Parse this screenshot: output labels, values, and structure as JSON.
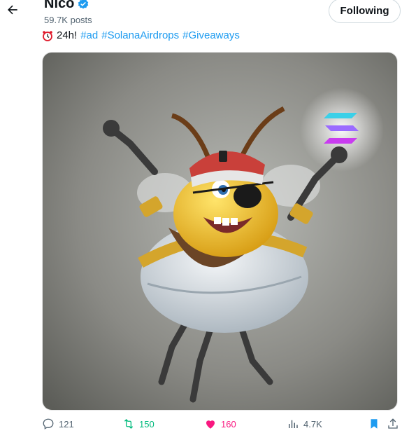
{
  "header": {
    "back_icon": "arrow-left-icon",
    "name": "Nico",
    "verified_icon": "verified-badge-icon",
    "posts": "59.7K posts",
    "follow_label": "Following"
  },
  "tweet": {
    "emoji_icon": "alarm-clock-icon",
    "text": "24h!",
    "hashtags": [
      "#ad",
      "#SolanaAirdrops",
      "#Giveaways"
    ]
  },
  "media": {
    "description_icon": "bee-mascot-image"
  },
  "actions": {
    "replies": "121",
    "retweets": "150",
    "likes": "160",
    "views": "4.7K"
  },
  "colors": {
    "accent": "#1d9bf0",
    "retweet": "#00ba7c",
    "like": "#f91880",
    "muted": "#536471"
  }
}
